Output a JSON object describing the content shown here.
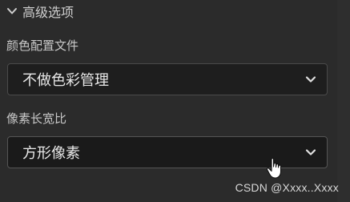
{
  "advanced": {
    "title": "高级选项",
    "expand_icon": "chevron-down-icon"
  },
  "color_profile": {
    "label": "颜色配置文件",
    "value": "不做色彩管理",
    "icon": "chevron-down-icon"
  },
  "pixel_aspect": {
    "label": "像素长宽比",
    "value": "方形像素",
    "icon": "chevron-down-icon"
  },
  "cursor": {
    "icon": "hand-pointer-icon"
  },
  "watermark": {
    "text": "CSDN @Xxxx..Xxxx"
  },
  "colors": {
    "background": "#2b2b2b",
    "select_bg": "#1e1e1e",
    "text": "#e8e8e8",
    "label": "#c8c8c8"
  }
}
